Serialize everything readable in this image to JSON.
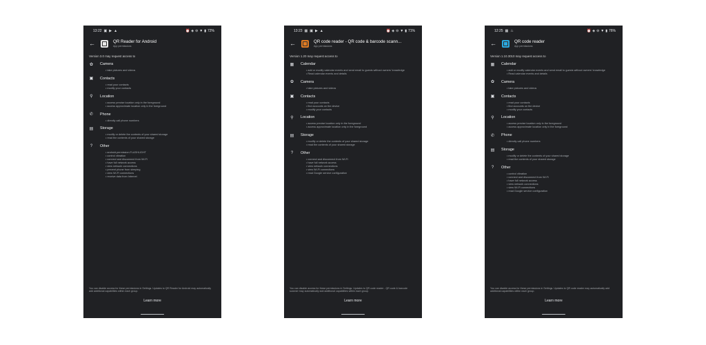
{
  "screens": [
    {
      "status": {
        "time": "13:22",
        "battery": "72%",
        "left_icons": [
          "image-icon",
          "play-icon",
          "alert-icon"
        ]
      },
      "app": {
        "title": "QR Reader for Android",
        "subtitle": "App permissions",
        "icon_color": "#e8e8e8",
        "icon_name": "qr-app-icon"
      },
      "version": "Version 3.0 may request access to",
      "groups": [
        {
          "icon": "camera-icon",
          "glyph": "✿",
          "label": "Camera",
          "items": [
            "• take pictures and videos"
          ]
        },
        {
          "icon": "contacts-icon",
          "glyph": "▣",
          "label": "Contacts",
          "items": [
            "• read your contacts",
            "• modify your contacts"
          ]
        },
        {
          "icon": "location-icon",
          "glyph": "⚲",
          "label": "Location",
          "items": [
            "• access precise location only in the foreground",
            "• access approximate location only in the foreground"
          ]
        },
        {
          "icon": "phone-icon",
          "glyph": "✆",
          "label": "Phone",
          "items": [
            "• directly call phone numbers"
          ]
        },
        {
          "icon": "storage-icon",
          "glyph": "▤",
          "label": "Storage",
          "items": [
            "• modify or delete the contents of your shared storage",
            "• read the contents of your shared storage"
          ]
        },
        {
          "icon": "other-icon",
          "glyph": "?",
          "label": "Other",
          "items": [
            "• android.permission.FLASHLIGHT",
            "• control vibration",
            "• connect and disconnect from Wi-Fi",
            "• have full network access",
            "• view network connections",
            "• prevent phone from sleeping",
            "• view Wi-Fi connections",
            "• receive data from Internet"
          ]
        }
      ],
      "footer": "You can disable access for these permissions in Settings. Updates to QR Reader for Android may automatically add additional capabilities within each group.",
      "learn_more": "Learn more"
    },
    {
      "status": {
        "time": "13:23",
        "battery": "71%",
        "left_icons": [
          "calendar-icon",
          "image-icon",
          "play-icon",
          "alert-icon"
        ]
      },
      "app": {
        "title": "QR code reader - QR code & barcode scann...",
        "subtitle": "App permissions",
        "icon_color": "#e07b22",
        "icon_name": "qr-app-icon"
      },
      "version": "Version 1.20 may request access to",
      "groups": [
        {
          "icon": "calendar-icon",
          "glyph": "▦",
          "label": "Calendar",
          "items": [
            "• add or modify calendar events and send email to guests without owners' knowledge",
            "• Read calendar events and details"
          ]
        },
        {
          "icon": "camera-icon",
          "glyph": "✿",
          "label": "Camera",
          "items": [
            "• take pictures and videos"
          ]
        },
        {
          "icon": "contacts-icon",
          "glyph": "▣",
          "label": "Contacts",
          "items": [
            "• read your contacts",
            "• find accounts on the device",
            "• modify your contacts"
          ]
        },
        {
          "icon": "location-icon",
          "glyph": "⚲",
          "label": "Location",
          "items": [
            "• access precise location only in the foreground",
            "• access approximate location only in the foreground"
          ]
        },
        {
          "icon": "storage-icon",
          "glyph": "▤",
          "label": "Storage",
          "items": [
            "• modify or delete the contents of your shared storage",
            "• read the contents of your shared storage"
          ]
        },
        {
          "icon": "other-icon",
          "glyph": "?",
          "label": "Other",
          "items": [
            "• connect and disconnect from Wi-Fi",
            "• have full network access",
            "• view network connections",
            "• view Wi-Fi connections",
            "• read Google service configuration"
          ]
        }
      ],
      "footer": "You can disable access for these permissions in Settings. Updates to QR code reader - QR code & barcode scanner may automatically add additional capabilities within each group.",
      "learn_more": "Learn more"
    },
    {
      "status": {
        "time": "12:25",
        "battery": "76%",
        "left_icons": [
          "calendar-icon",
          "fire-icon"
        ]
      },
      "app": {
        "title": "QR code reader",
        "subtitle": "App permissions",
        "icon_color": "#29a9e0",
        "icon_name": "qr-app-icon"
      },
      "version": "Version 1.10.3010 may request access to",
      "groups": [
        {
          "icon": "calendar-icon",
          "glyph": "▦",
          "label": "Calendar",
          "items": [
            "• add or modify calendar events and send email to guests without owners' knowledge",
            "• Read calendar events and details"
          ]
        },
        {
          "icon": "camera-icon",
          "glyph": "✿",
          "label": "Camera",
          "items": [
            "• take pictures and videos"
          ]
        },
        {
          "icon": "contacts-icon",
          "glyph": "▣",
          "label": "Contacts",
          "items": [
            "• read your contacts",
            "• find accounts on the device",
            "• modify your contacts"
          ]
        },
        {
          "icon": "location-icon",
          "glyph": "⚲",
          "label": "Location",
          "items": [
            "• access precise location only in the foreground",
            "• access approximate location only in the foreground"
          ]
        },
        {
          "icon": "phone-icon",
          "glyph": "✆",
          "label": "Phone",
          "items": [
            "• directly call phone numbers"
          ]
        },
        {
          "icon": "storage-icon",
          "glyph": "▤",
          "label": "Storage",
          "items": [
            "• modify or delete the contents of your shared storage",
            "• read the contents of your shared storage"
          ]
        },
        {
          "icon": "other-icon",
          "glyph": "?",
          "label": "Other",
          "items": [
            "• control vibration",
            "• connect and disconnect from Wi-Fi",
            "• have full network access",
            "• view network connections",
            "• view Wi-Fi connections",
            "• read Google service configuration"
          ]
        }
      ],
      "footer": "You can disable access for these permissions in Settings. Updates to QR code reader may automatically add additional capabilities within each group.",
      "learn_more": "Learn more"
    }
  ]
}
